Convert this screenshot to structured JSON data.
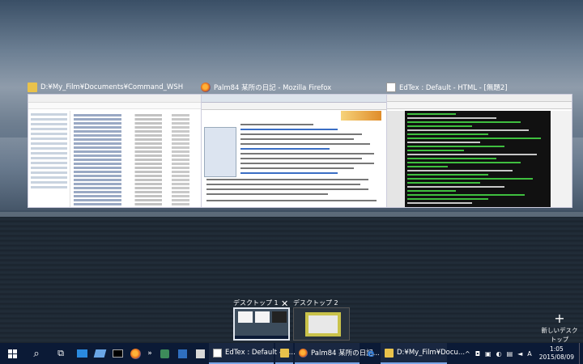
{
  "windows": [
    {
      "title": "D:¥My_Film¥Documents¥Command_WSH",
      "icon": "folder-icon"
    },
    {
      "title": "Palm84 某所の日記 - Mozilla Firefox",
      "icon": "firefox-icon"
    },
    {
      "title": "EdTex : Default - HTML - [無題2]",
      "icon": "editor-icon"
    }
  ],
  "desktops": [
    {
      "label": "デスクトップ 1",
      "active": true
    },
    {
      "label": "デスクトップ 2",
      "active": false
    }
  ],
  "close_glyph": "✕",
  "new_desktop": {
    "plus": "+",
    "label": "新しいデスクトップ"
  },
  "taskbar": {
    "search_glyph": "⌕",
    "task_view_glyph": "⧉",
    "overflow_glyph": "»",
    "tasks": [
      {
        "label": "EdTex : Default - H...",
        "icon": "editor-icon"
      },
      {
        "label": "",
        "icon": "folder-icon"
      },
      {
        "label": "Palm84 某所の日記...",
        "icon": "firefox-icon"
      },
      {
        "label": "",
        "icon": "edge-icon"
      },
      {
        "label": "D:¥My_Film¥Docu...",
        "icon": "folder-icon"
      }
    ],
    "tray": {
      "chevron": "^",
      "ime": "A",
      "time": "1:05",
      "date": "2015/08/09"
    }
  },
  "colors": {
    "taskbar": "#0b1a36",
    "accent": "#7aa6e6",
    "code_green": "#3fbf3f"
  }
}
